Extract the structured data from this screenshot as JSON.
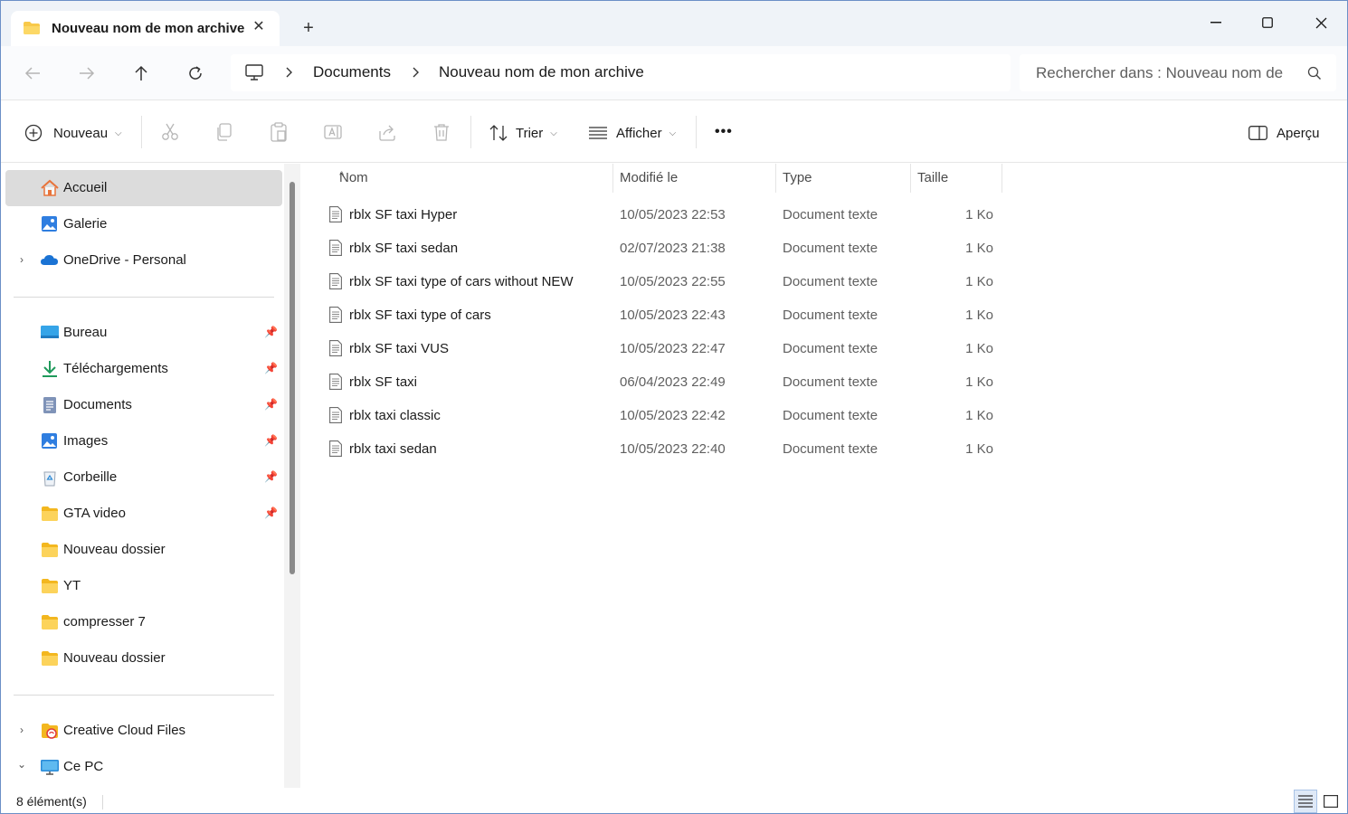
{
  "titlebar": {
    "tab_title": "Nouveau nom de mon archive",
    "tab_icon": "folder-icon",
    "new_tab_icon": "plus-icon",
    "close_icon": "close-icon"
  },
  "nav": {
    "back_icon": "arrow-left-icon",
    "forward_icon": "arrow-right-icon",
    "up_icon": "arrow-up-icon",
    "refresh_icon": "refresh-icon"
  },
  "address": {
    "root_icon": "computer-icon",
    "crumbs": [
      "Documents",
      "Nouveau nom de mon archive"
    ]
  },
  "search": {
    "placeholder": "Rechercher dans : Nouveau nom de"
  },
  "toolbar": {
    "new_label": "Nouveau",
    "sort_label": "Trier",
    "view_label": "Afficher",
    "more_label": "•••",
    "preview_label": "Aperçu"
  },
  "sidebar": {
    "top": [
      {
        "label": "Accueil",
        "icon": "home-icon",
        "selected": true
      },
      {
        "label": "Galerie",
        "icon": "gallery-icon"
      },
      {
        "label": "OneDrive - Personal",
        "icon": "cloud-icon"
      }
    ],
    "pinned": [
      {
        "label": "Bureau",
        "icon": "desktop-icon"
      },
      {
        "label": "Téléchargements",
        "icon": "download-icon"
      },
      {
        "label": "Documents",
        "icon": "documents-icon"
      },
      {
        "label": "Images",
        "icon": "images-icon"
      },
      {
        "label": "Corbeille",
        "icon": "recycle-bin-icon"
      },
      {
        "label": "GTA video",
        "icon": "folder-icon"
      }
    ],
    "folders": [
      {
        "label": "Nouveau dossier",
        "icon": "folder-icon"
      },
      {
        "label": "YT",
        "icon": "folder-icon"
      },
      {
        "label": "compresser 7",
        "icon": "folder-icon"
      },
      {
        "label": "Nouveau dossier",
        "icon": "folder-icon"
      }
    ],
    "bottom": [
      {
        "label": "Creative Cloud Files",
        "icon": "creative-cloud-icon"
      },
      {
        "label": "Ce PC",
        "icon": "computer-icon"
      }
    ]
  },
  "columns": {
    "name": "Nom",
    "modified": "Modifié le",
    "type": "Type",
    "size": "Taille"
  },
  "files": [
    {
      "name": "rblx SF taxi Hyper",
      "modified": "10/05/2023 22:53",
      "type": "Document texte",
      "size": "1 Ko"
    },
    {
      "name": "rblx SF taxi sedan",
      "modified": "02/07/2023 21:38",
      "type": "Document texte",
      "size": "1 Ko"
    },
    {
      "name": "rblx SF taxi type of cars without NEW",
      "modified": "10/05/2023 22:55",
      "type": "Document texte",
      "size": "1 Ko"
    },
    {
      "name": "rblx SF taxi type of cars",
      "modified": "10/05/2023 22:43",
      "type": "Document texte",
      "size": "1 Ko"
    },
    {
      "name": "rblx SF taxi VUS",
      "modified": "10/05/2023 22:47",
      "type": "Document texte",
      "size": "1 Ko"
    },
    {
      "name": "rblx SF taxi",
      "modified": "06/04/2023 22:49",
      "type": "Document texte",
      "size": "1 Ko"
    },
    {
      "name": "rblx taxi classic",
      "modified": "10/05/2023 22:42",
      "type": "Document texte",
      "size": "1 Ko"
    },
    {
      "name": "rblx taxi sedan",
      "modified": "10/05/2023 22:40",
      "type": "Document texte",
      "size": "1 Ko"
    }
  ],
  "status": {
    "count_text": "8 élément(s)"
  },
  "colors": {
    "accent": "#0067c0",
    "folder": "#f8c94a",
    "selected_bg": "#dcdcdc"
  }
}
